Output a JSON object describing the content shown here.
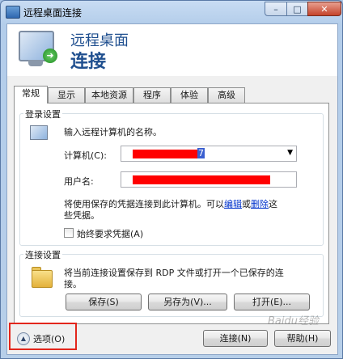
{
  "window": {
    "title": "远程桌面连接",
    "minimize_glyph": "–",
    "maximize_glyph": "□",
    "close_glyph": "✕"
  },
  "header": {
    "line1": "远程桌面",
    "line2": "连接",
    "badge_glyph": "➜"
  },
  "tabs": [
    {
      "label": "常规",
      "active": true
    },
    {
      "label": "显示",
      "active": false
    },
    {
      "label": "本地资源",
      "active": false
    },
    {
      "label": "程序",
      "active": false
    },
    {
      "label": "体验",
      "active": false
    },
    {
      "label": "高级",
      "active": false
    }
  ],
  "login": {
    "group_label": "登录设置",
    "prompt": "输入远程计算机的名称。",
    "computer_label": "计算机(C):",
    "computer_value_tail": "7",
    "user_label": "用户名:",
    "note_part1": "将使用保存的凭据连接到此计算机。可以",
    "edit_link": "编辑",
    "or_text": "或",
    "delete_link": "删除",
    "note_part2": "这",
    "note_line2": "些凭据。",
    "always_ask": "始终要求凭据(A)"
  },
  "connection": {
    "group_label": "连接设置",
    "desc_line1": "将当前连接设置保存到 RDP 文件或打开一个已保存的连",
    "desc_line2": "接。",
    "save_label": "保存(S)",
    "save_as_label": "另存为(V)...",
    "open_label": "打开(E)..."
  },
  "footer": {
    "options_label": "选项(O)",
    "options_glyph": "▲",
    "connect_label": "连接(N)",
    "help_label": "帮助(H)",
    "watermark": "Baidu经验"
  },
  "colors": {
    "redaction": "#ff0000",
    "highlight_box": "#e2261c",
    "link": "#0033cc"
  }
}
